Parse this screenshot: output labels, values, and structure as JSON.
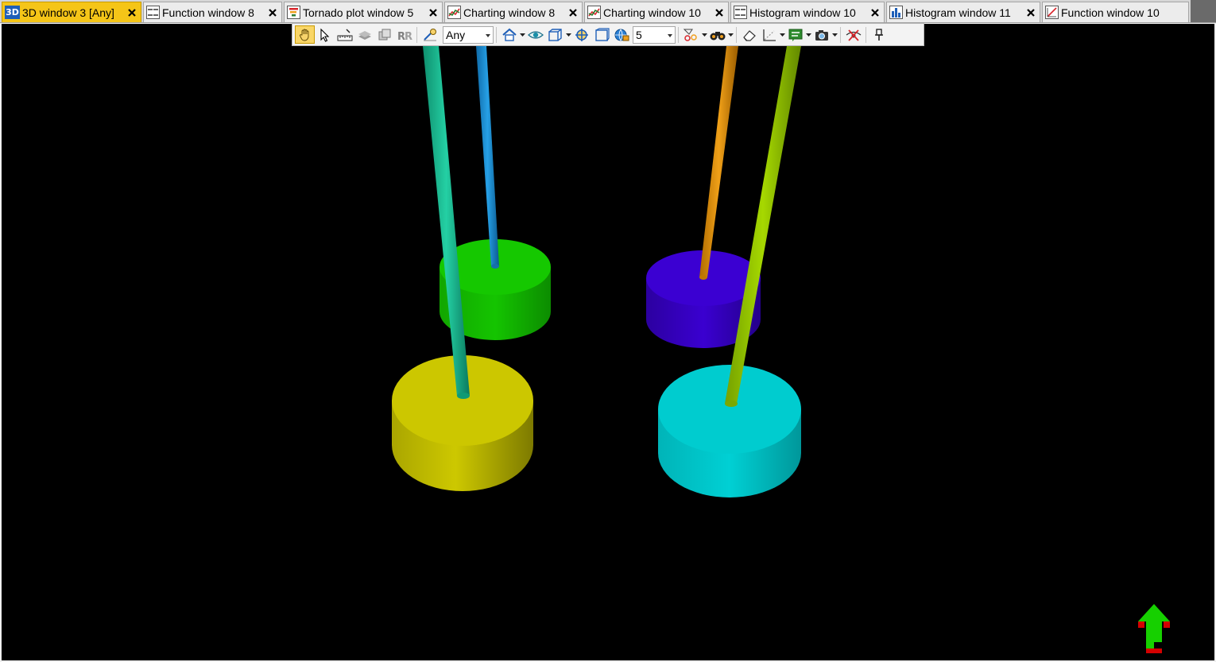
{
  "tabs": [
    {
      "label": "3D window 3 [Any]",
      "icon": "3d-window-icon",
      "icon_text": "3D",
      "active": true
    },
    {
      "label": "Function window 8",
      "icon": "grid-window-icon",
      "active": false
    },
    {
      "label": "Tornado plot window 5",
      "icon": "tornado-plot-icon",
      "active": false
    },
    {
      "label": "Charting window 8",
      "icon": "charting-icon",
      "active": false
    },
    {
      "label": "Charting window 10",
      "icon": "charting-icon",
      "active": false
    },
    {
      "label": "Histogram window 10",
      "icon": "grid-window-icon",
      "active": false
    },
    {
      "label": "Histogram window 11",
      "icon": "histogram-icon",
      "active": false
    },
    {
      "label": "Function window 10",
      "icon": "function-icon",
      "active": false
    }
  ],
  "toolbar": {
    "domain_value": "Any",
    "level_value": "5"
  },
  "scene": {
    "background": "#000000",
    "objects": [
      {
        "name": "green-cylinder",
        "color": "#11c200"
      },
      {
        "name": "blue-purple-cylinder",
        "color": "#3500c8"
      },
      {
        "name": "yellow-cylinder",
        "color": "#c9c400"
      },
      {
        "name": "cyan-cylinder",
        "color": "#00c8cc"
      },
      {
        "name": "teal-pipe",
        "color": "#13b58d"
      },
      {
        "name": "blue-pipe",
        "color": "#1a86c8"
      },
      {
        "name": "orange-pipe",
        "color": "#d88a00"
      },
      {
        "name": "lime-pipe",
        "color": "#8cbf00"
      }
    ],
    "orientation_indicator": "north-arrow-icon"
  }
}
